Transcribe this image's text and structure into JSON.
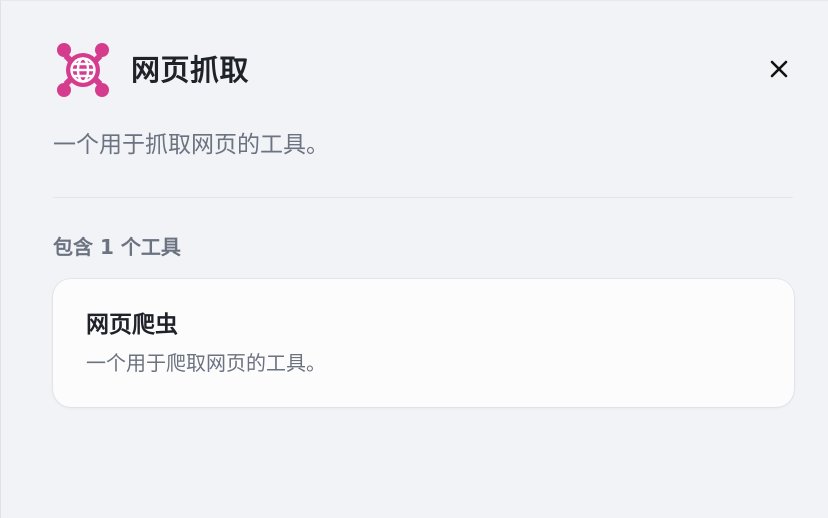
{
  "plugin": {
    "icon": "globe-network-icon",
    "icon_color": "#d63c8e",
    "title": "网页抓取",
    "description": "一个用于抓取网页的工具。"
  },
  "close_icon": "close-icon",
  "tools_section": {
    "count_label": "包含 1 个工具",
    "tools": [
      {
        "name": "网页爬虫",
        "description": "一个用于爬取网页的工具。"
      }
    ]
  }
}
